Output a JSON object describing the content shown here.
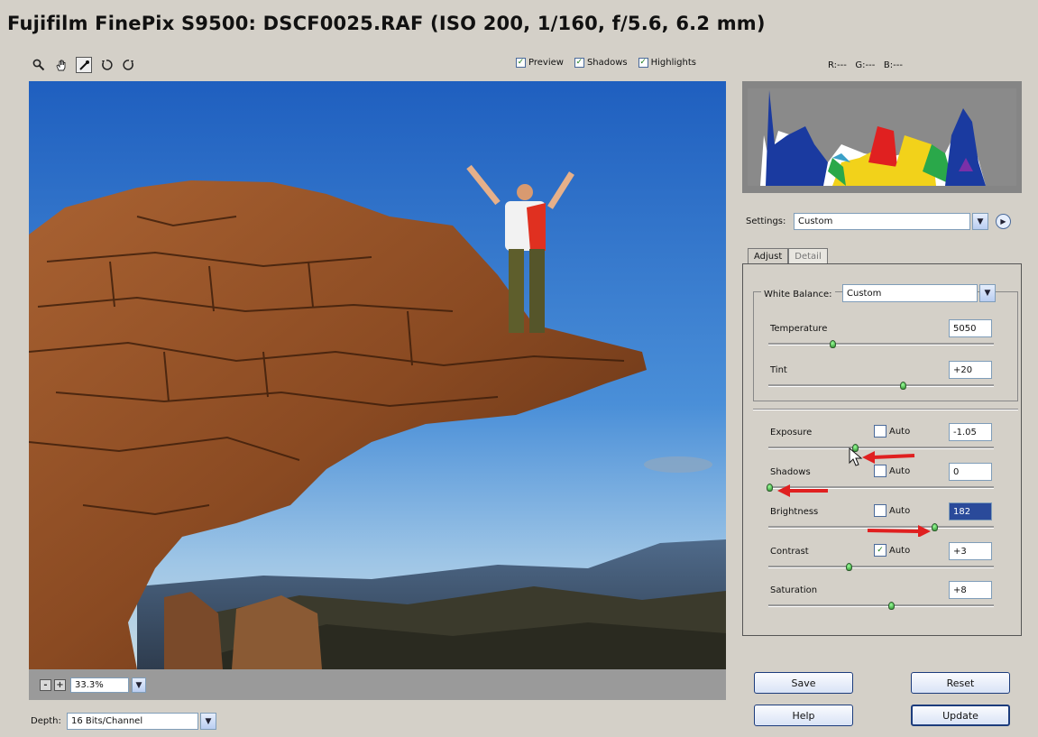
{
  "window": {
    "title": "Fujifilm FinePix S9500:  DSCF0025.RAF  (ISO 200, 1/160, f/5.6, 6.2 mm)"
  },
  "toolbar": {
    "tools": [
      "zoom-icon",
      "hand-icon",
      "eyedropper-icon",
      "rotate-left-icon",
      "rotate-right-icon"
    ],
    "checkboxes": [
      {
        "label": "Preview",
        "checked": true
      },
      {
        "label": "Shadows",
        "checked": true
      },
      {
        "label": "Highlights",
        "checked": true
      }
    ]
  },
  "rgb_readout": {
    "r_label": "R:",
    "r_value": "---",
    "g_label": "G:",
    "g_value": "---",
    "b_label": "B:",
    "b_value": "---"
  },
  "zoom": {
    "minus": "-",
    "plus": "+",
    "value": "33.3%"
  },
  "depth": {
    "label": "Depth:",
    "value": "16 Bits/Channel"
  },
  "settings": {
    "label": "Settings:",
    "value": "Custom"
  },
  "tabs": [
    {
      "label": "Adjust",
      "active": true
    },
    {
      "label": "Detail",
      "active": false
    }
  ],
  "white_balance": {
    "label": "White Balance:",
    "value": "Custom"
  },
  "sliders": [
    {
      "label": "Temperature",
      "value": "5050",
      "has_auto": false,
      "position": 0.28
    },
    {
      "label": "Tint",
      "value": "+20",
      "has_auto": false,
      "position": 0.59
    },
    {
      "label": "Exposure",
      "value": "-1.05",
      "has_auto": true,
      "auto_label": "Auto",
      "auto_checked": false,
      "position": 0.38
    },
    {
      "label": "Shadows",
      "value": "0",
      "has_auto": true,
      "auto_label": "Auto",
      "auto_checked": false,
      "position": 0.0
    },
    {
      "label": "Brightness",
      "value": "182",
      "has_auto": true,
      "auto_label": "Auto",
      "auto_checked": false,
      "position": 0.73
    },
    {
      "label": "Contrast",
      "value": "+3",
      "has_auto": true,
      "auto_label": "Auto",
      "auto_checked": true,
      "position": 0.35
    },
    {
      "label": "Saturation",
      "value": "+8",
      "has_auto": false,
      "position": 0.54
    }
  ],
  "buttons": {
    "save": "Save",
    "reset": "Reset",
    "help": "Help",
    "update": "Update"
  },
  "colors": {
    "accent_red": "#e02020",
    "sky": "#2b70c8",
    "rock": "#8a4a22"
  }
}
